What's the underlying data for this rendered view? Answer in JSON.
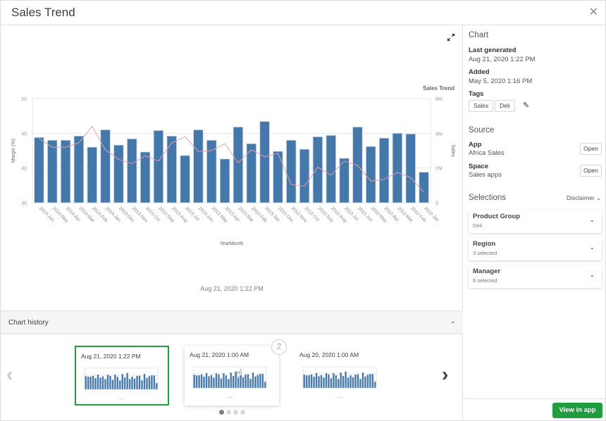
{
  "header": {
    "title": "Sales Trend",
    "close_icon": "close-icon"
  },
  "main": {
    "expand_icon": "expand-icon",
    "generated_label": "Aug 21, 2020 1:22 PM",
    "history": {
      "label": "Chart history",
      "cards": [
        {
          "date": "Aug 21, 2020 1:22 PM",
          "state": "selected"
        },
        {
          "date": "Aug 21, 2020 1:00 AM",
          "state": "hover"
        },
        {
          "date": "Aug 20, 2020 1:00 AM",
          "state": "normal"
        }
      ],
      "badge": "2",
      "pages": 4,
      "active_page": 1
    }
  },
  "side": {
    "chart_heading": "Chart",
    "last_generated_label": "Last generated",
    "last_generated_value": "Aug 21, 2020 1:22 PM",
    "added_label": "Added",
    "added_value": "May 5, 2020 1:16 PM",
    "tags_label": "Tags",
    "tags": [
      "Sales",
      "Deli"
    ],
    "source_heading": "Source",
    "app_label": "App",
    "app_value": "Africa Sales",
    "space_label": "Space",
    "space_value": "Sales apps",
    "open_label": "Open",
    "selections_heading": "Selections",
    "disclaimer_label": "Disclaimer",
    "selections": [
      {
        "name": "Product Group",
        "value": "Deli"
      },
      {
        "name": "Region",
        "value": "3 selected"
      },
      {
        "name": "Manager",
        "value": "6 selected"
      }
    ],
    "view_button": "View in app"
  },
  "colors": {
    "bar": "#4477aa",
    "line": "#e8a0a8",
    "accent": "#1f9d3f"
  },
  "chart_data": {
    "type": "bar",
    "title": "Sales Trend",
    "xlabel": "YearMonth",
    "ylabel": "Margin (%)",
    "y2label": "Sales",
    "ylim": [
      35,
      50
    ],
    "y2lim": [
      0,
      6000000
    ],
    "yticks": [
      "35",
      "40",
      "45",
      "50"
    ],
    "y2ticks": [
      "0",
      "2M",
      "4M",
      "6M"
    ],
    "grid": true,
    "categories": [
      "2014-Jun",
      "2014-May",
      "2014-Apr",
      "2014-Mar",
      "2014-Feb",
      "2014-Jan",
      "2013-Dec",
      "2013-Nov",
      "2013-Oct",
      "2013-Sep",
      "2013-Aug",
      "2013-Jul",
      "2013-Jun",
      "2013-May",
      "2013-Apr",
      "2013-Mar",
      "2013-Feb",
      "2013-Jan",
      "2012-Dec",
      "2012-Nov",
      "2012-Oct",
      "2012-Sep",
      "2012-Aug",
      "2012-Jul",
      "2012-Jun",
      "2012-May",
      "2012-Apr",
      "2012-Mar",
      "2012-Feb",
      "2012-Jan"
    ],
    "series": [
      {
        "name": "Margin (%)",
        "type": "bar",
        "axis": "left",
        "values": [
          44.4,
          44.0,
          44.0,
          44.6,
          43.0,
          45.5,
          43.3,
          44.2,
          42.3,
          45.4,
          44.6,
          41.8,
          45.5,
          44.0,
          41.3,
          45.9,
          43.5,
          46.7,
          42.4,
          44.0,
          42.7,
          44.5,
          44.7,
          41.4,
          45.9,
          43.1,
          44.3,
          45.0,
          44.9,
          39.4
        ]
      },
      {
        "name": "Sales",
        "type": "line",
        "axis": "right",
        "values": [
          3700000,
          3200000,
          3200000,
          3450000,
          4400000,
          3050000,
          2500000,
          2250000,
          2700000,
          2400000,
          3450000,
          3800000,
          2950000,
          3000000,
          3400000,
          2300000,
          3050000,
          2650000,
          2850000,
          1050000,
          950000,
          2050000,
          1600000,
          2400000,
          2150000,
          1250000,
          1350000,
          1750000,
          1450000,
          600000
        ]
      }
    ]
  }
}
